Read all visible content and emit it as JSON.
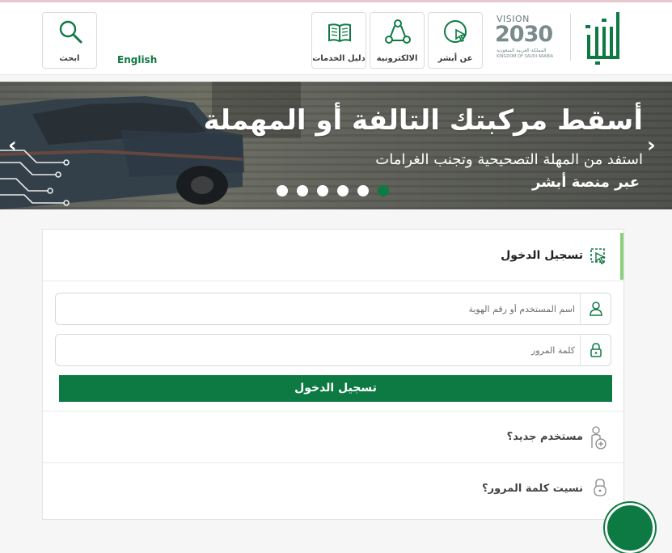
{
  "header": {
    "logo_text": "أبشر",
    "vision": {
      "word": "VISION",
      "year": "2030",
      "country_ar": "المملكة العربية السعودية",
      "country_en": "KINGDOM OF SAUDI ARABIA"
    },
    "nav": [
      {
        "label": "عن أبشر",
        "icon": "cursor-click-icon"
      },
      {
        "label": "الالكترونية",
        "icon": "network-icon"
      },
      {
        "label": "دليل الخدمات",
        "icon": "book-icon"
      }
    ],
    "language_link": "English",
    "search_label": "ابحث",
    "accent_color": "#0e7a43"
  },
  "banner": {
    "title": "أسقط مركبتك التالفة أو المهملة",
    "subtitle": "استفد من المهلة التصحيحية وتجنب الغرامات",
    "subtitle2": "عبر منصة أبشر",
    "slide_count": 6,
    "active_slide": 6
  },
  "login": {
    "title": "تسجيل الدخول",
    "username_placeholder": "اسم المستخدم أو رقم الهوية",
    "password_placeholder": "كلمة المرور",
    "submit_label": "تسجيل الدخول",
    "new_user_label": "مستخدم جديد؟",
    "forgot_password_label": "نسيت كلمة المرور؟"
  }
}
